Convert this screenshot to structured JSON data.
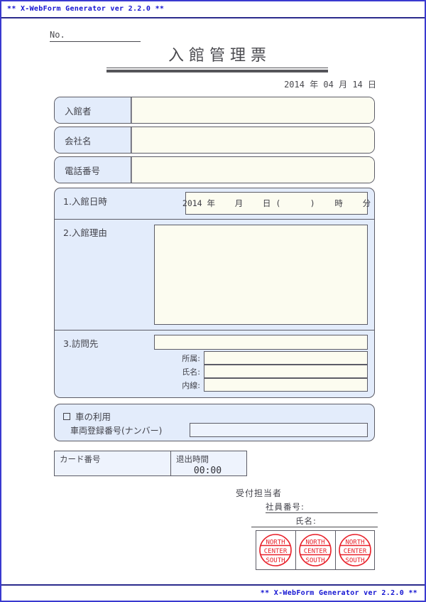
{
  "generator": {
    "banner": "** X-WebForm Generator ver 2.2.0 **"
  },
  "header": {
    "no_label": "No.",
    "title": "入館管理票",
    "date_line": "2014 年 04 月 14 日"
  },
  "identity_rows": [
    {
      "label": "入館者",
      "value": ""
    },
    {
      "label": "会社名",
      "value": ""
    },
    {
      "label": "電話番号",
      "value": ""
    }
  ],
  "sections": {
    "datetime": {
      "label": "1.入館日時",
      "field_text": "2014 年    月    日 (      )    時    分"
    },
    "reason": {
      "label": "2.入館理由",
      "value": ""
    },
    "destination": {
      "label": "3.訪問先",
      "main_value": "",
      "subfields": [
        {
          "label": "所属:",
          "value": ""
        },
        {
          "label": "氏名:",
          "value": ""
        },
        {
          "label": "内線:",
          "value": ""
        }
      ]
    }
  },
  "car": {
    "checkbox_label": "車の利用",
    "checked": false,
    "number_label": "車両登録番号(ナンバー)",
    "number_value": ""
  },
  "card_table": {
    "card_label": "カード番号",
    "card_value": "",
    "exit_label": "退出時間",
    "exit_value": "00:00"
  },
  "reception": {
    "title": "受付担当者",
    "employee_no_label": "社員番号:",
    "employee_no_value": "",
    "name_label": "氏名:",
    "name_value": ""
  },
  "stamps": {
    "color": "#e8202a",
    "cells": [
      {
        "top": "NORTH",
        "middle": "CENTER",
        "bottom": "SOUTH"
      },
      {
        "top": "NORTH",
        "middle": "CENTER",
        "bottom": "SOUTH"
      },
      {
        "top": "NORTH",
        "middle": "CENTER",
        "bottom": "SOUTH"
      }
    ]
  },
  "colors": {
    "label_blue": "#e3ecfb",
    "field_cream": "#fcfcf0",
    "border_gray": "#5c5c66",
    "banner_blue": "#1414d2",
    "stamp_red": "#e8202a"
  }
}
